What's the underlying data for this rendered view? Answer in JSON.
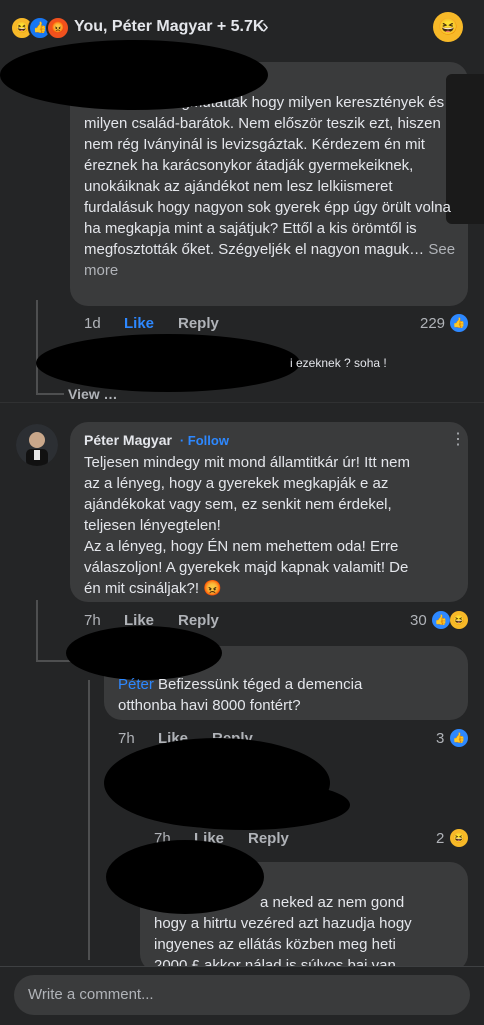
{
  "header": {
    "title": "You, Péter Magyar + 5.7K",
    "reactions": [
      "haha-icon",
      "like-icon",
      "angry-icon"
    ]
  },
  "comment1": {
    "text": "Ohok most megmutatták hogy milyen keresztények és milyen család-barátok. Nem először teszik ezt, hiszen nem rég Iványinál is levizsgáztak. Kérdezem én mit éreznek ha karácsonykor átadják gyermekeiknek, unokáiknak az ajándékot nem lesz lelkiismeret furdalásuk hogy nagyon sok gyerek épp úgy örült volna ha megkapja mint a sajátjuk? Ettől a kis örömtől is megfosztották őket. Szégyeljék el nagyon maguk…",
    "see_more": "See more",
    "time": "1d",
    "like": "Like",
    "reply": "Reply",
    "reaction_count": "229"
  },
  "reply_preview": {
    "text": "i ezeknek ? soha !"
  },
  "view_replies": "View …",
  "comment2": {
    "author": "Péter Magyar",
    "follow": "· Follow",
    "text_lines": [
      "Teljesen mindegy mit mond államtitkár úr! Itt nem",
      "az a lényeg, hogy a gyerekek megkapják e az",
      "ajándékokat vagy sem, ez senkit nem érdekel,",
      "teljesen lényegtelen!",
      "Az a lényeg, hogy ÉN nem mehettem oda! Erre",
      "válaszoljon! A gyerekek majd kapnak valamit! De",
      "én mit csináljak?! 😡"
    ],
    "time": "7h",
    "like": "Like",
    "reply": "Reply",
    "reaction_count": "30"
  },
  "reply1": {
    "mention": "Péter",
    "text_line1": "Befizessünk téged a demencia",
    "text_line2": "otthonba havi 8000 fontért?",
    "time": "7h",
    "like": "Like",
    "reply": "Reply",
    "reaction_count": "3"
  },
  "reply2": {
    "time": "7h",
    "like": "Like",
    "reply": "Reply",
    "reaction_count": "2"
  },
  "reply3": {
    "text_line1": "a neked az nem gond",
    "text_line2": "hogy a hitrtu vezéred azt hazudja hogy",
    "text_line3": "ingyenes az ellátás közben meg heti",
    "text_line4": "2000 £ akkor nálad is súlyos baj van"
  },
  "composer": {
    "placeholder": "Write a comment..."
  },
  "colors": {
    "background": "#242526",
    "bubble": "#3a3b3c",
    "link": "#2d88ff",
    "muted": "#b0b3b8"
  }
}
